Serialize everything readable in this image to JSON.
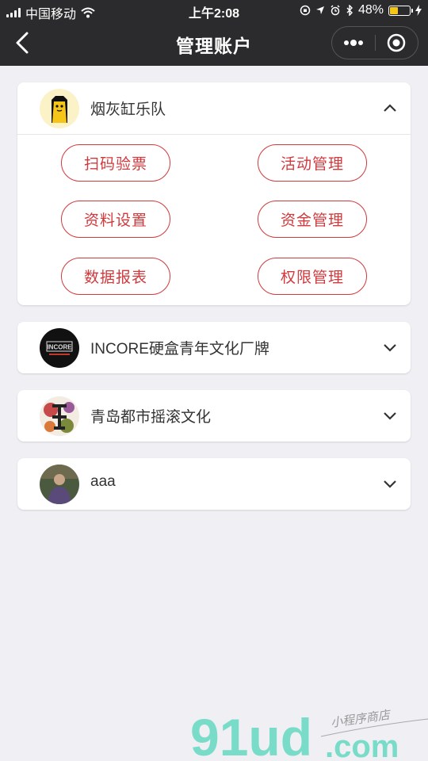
{
  "status_bar": {
    "carrier": "中国移动",
    "time": "上午2:08",
    "battery": "48%",
    "battery_level": 0.48
  },
  "nav": {
    "title": "管理账户"
  },
  "accounts": [
    {
      "name": "烟灰缸乐队",
      "expanded": true
    },
    {
      "name": "INCORE硬盒青年文化厂牌",
      "expanded": false,
      "logo_text": "INCORE"
    },
    {
      "name": "青岛都市摇滚文化",
      "expanded": false
    },
    {
      "name": "aaa",
      "expanded": false
    }
  ],
  "actions": [
    "扫码验票",
    "活动管理",
    "资料设置",
    "资金管理",
    "数据报表",
    "权限管理"
  ],
  "watermark": {
    "brand": "91ud",
    "domain": ".com",
    "tagline": "小程序商店"
  },
  "colors": {
    "accent": "#d2393c",
    "nav_bg": "#2b2b2d",
    "page_bg": "#efeff4",
    "watermark": "#78dcc8"
  }
}
